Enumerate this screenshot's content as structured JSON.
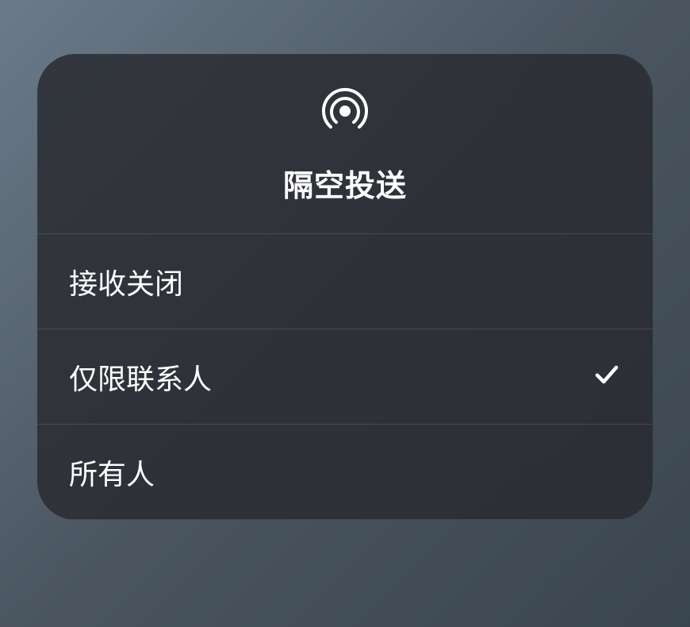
{
  "panel": {
    "title": "隔空投送",
    "icon": "airdrop-icon",
    "options": [
      {
        "label": "接收关闭",
        "selected": false
      },
      {
        "label": "仅限联系人",
        "selected": true
      },
      {
        "label": "所有人",
        "selected": false
      }
    ]
  }
}
